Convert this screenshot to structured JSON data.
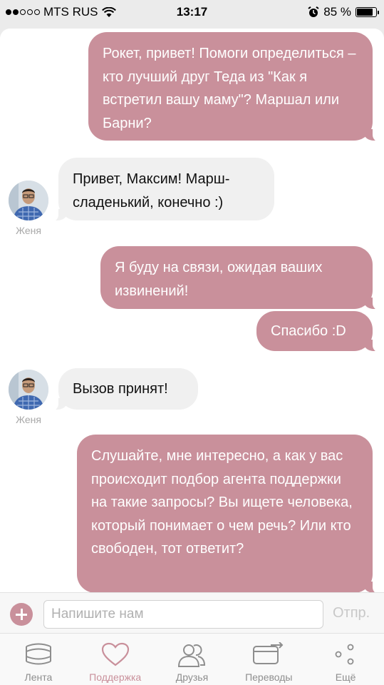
{
  "status_bar": {
    "carrier": "MTS RUS",
    "time": "13:17",
    "battery_percent": "85 %",
    "battery_level": 0.85,
    "signal_bars": 2
  },
  "colors": {
    "accent": "#c9909b",
    "incoming_bubble": "#f0f0f0",
    "background": "#ebebeb"
  },
  "messages": [
    {
      "direction": "out",
      "text": "Рокет, привет! Помоги определиться – кто лучший друг Теда из \"Как я встретил вашу маму\"? Маршал или Барни?"
    },
    {
      "direction": "in",
      "sender": "Женя",
      "text": "Привет, Максим! Марш- сладенький, конечно :)"
    },
    {
      "direction": "out",
      "text": "Я буду на связи, ожидая ваших извинений!"
    },
    {
      "direction": "out",
      "text": "Спасибо :D"
    },
    {
      "direction": "in",
      "sender": "Женя",
      "text": "Вызов принят!"
    },
    {
      "direction": "out",
      "text": "Слушайте, мне интересно, а как у вас происходит подбор агента поддержки на такие запросы? Вы ищете человека, который понимает о чем речь? Или кто свободен, тот ответит?"
    }
  ],
  "composer": {
    "placeholder": "Напишите нам",
    "send_label": "Отпр.",
    "add_icon": "plus-circle-icon"
  },
  "tabs": [
    {
      "label": "Лента",
      "icon": "feed-stack-icon",
      "active": false
    },
    {
      "label": "Поддержка",
      "icon": "heart-icon",
      "active": true
    },
    {
      "label": "Друзья",
      "icon": "friends-icon",
      "active": false
    },
    {
      "label": "Переводы",
      "icon": "transfer-card-icon",
      "active": false
    },
    {
      "label": "Ещё",
      "icon": "more-dots-icon",
      "active": false
    }
  ]
}
